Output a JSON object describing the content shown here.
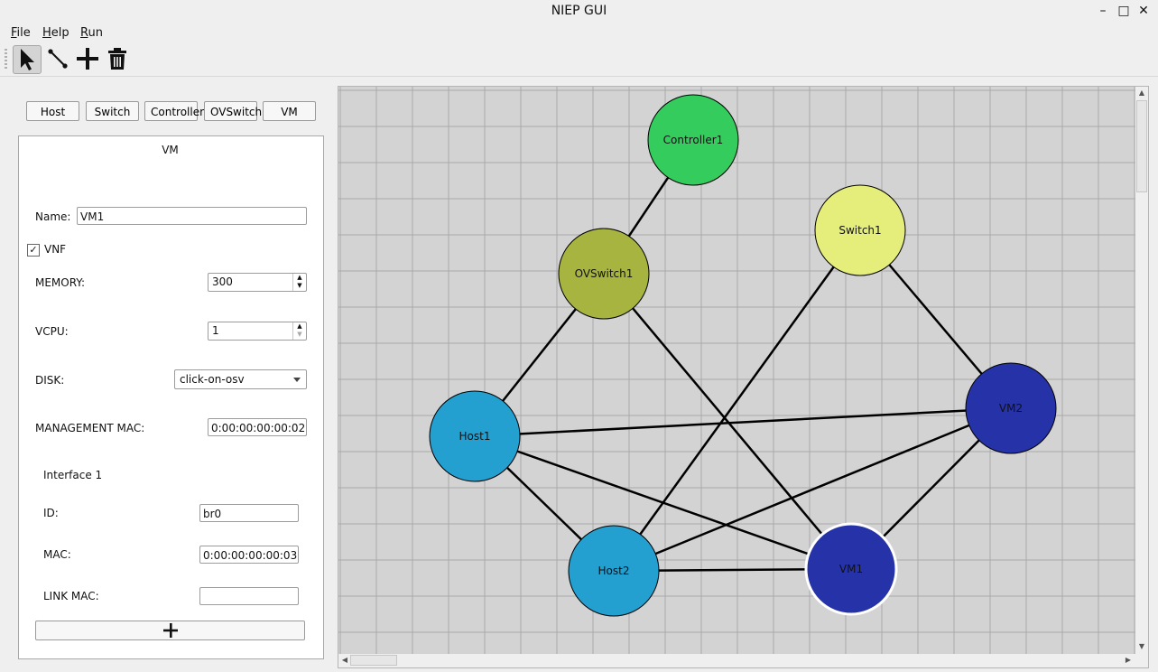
{
  "window": {
    "title": "NIEP GUI",
    "minimize": "–",
    "maximize": "□",
    "close": "✕"
  },
  "menu": [
    "File",
    "Help",
    "Run"
  ],
  "toolbar": {
    "tools": [
      "select-arrow-icon",
      "connect-line-icon",
      "add-node-icon",
      "delete-trash-icon"
    ],
    "active": "select-arrow-icon"
  },
  "node_types": [
    "Host",
    "Switch",
    "Controller",
    "OVSwitch",
    "VM"
  ],
  "form": {
    "title": "VM",
    "name_label": "Name:",
    "name_value": "VM1",
    "vnf_label": "VNF",
    "vnf_checked": true,
    "vnf_check": "✓",
    "memory_label": "MEMORY:",
    "memory_value": "300",
    "vcpu_label": "VCPU:",
    "vcpu_value": "1",
    "disk_label": "DISK:",
    "disk_value": "click-on-osv",
    "mgmt_mac_label": "MANAGEMENT MAC:",
    "mgmt_mac_value": "0:00:00:00:00:02",
    "interface_title": "Interface 1",
    "id_label": "ID:",
    "id_value": "br0",
    "mac_label": "MAC:",
    "mac_value": "0:00:00:00:00:03",
    "link_mac_label": "LINK MAC:",
    "link_mac_value": "",
    "add_label": "+"
  },
  "topology": {
    "colors": {
      "controller": "#35cc5e",
      "switch": "#e5ee7a",
      "ovswitch": "#a8b440",
      "host": "#239fd0",
      "vm": "#2633a8",
      "grid_bg": "#d3d3d3",
      "grid_line": "#a9a9a9"
    },
    "nodes": [
      {
        "id": "Controller1",
        "label": "Controller1",
        "type": "controller"
      },
      {
        "id": "Switch1",
        "label": "Switch1",
        "type": "switch"
      },
      {
        "id": "OVSwitch1",
        "label": "OVSwitch1",
        "type": "ovswitch"
      },
      {
        "id": "Host1",
        "label": "Host1",
        "type": "host"
      },
      {
        "id": "VM2",
        "label": "VM2",
        "type": "vm"
      },
      {
        "id": "Host2",
        "label": "Host2",
        "type": "host"
      },
      {
        "id": "VM1",
        "label": "VM1",
        "type": "vm",
        "selected": true
      }
    ],
    "links": [
      [
        "Controller1",
        "OVSwitch1"
      ],
      [
        "OVSwitch1",
        "Host1"
      ],
      [
        "OVSwitch1",
        "VM1"
      ],
      [
        "Switch1",
        "Host2"
      ],
      [
        "Switch1",
        "VM2"
      ],
      [
        "Host1",
        "VM2"
      ],
      [
        "Host1",
        "Host2"
      ],
      [
        "Host1",
        "VM1"
      ],
      [
        "Host2",
        "VM2"
      ],
      [
        "Host2",
        "VM1"
      ],
      [
        "VM1",
        "VM2"
      ]
    ]
  }
}
